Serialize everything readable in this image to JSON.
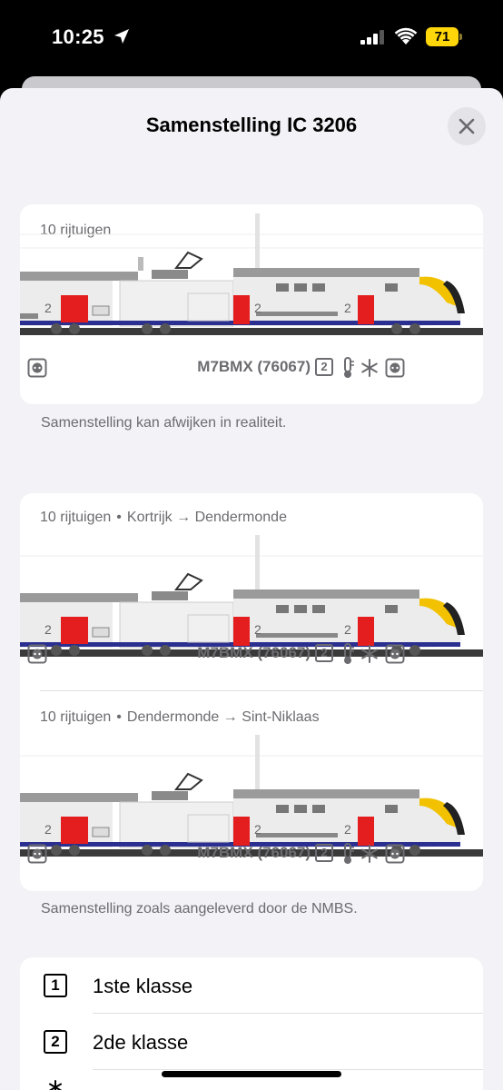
{
  "status_bar": {
    "time": "10:25",
    "battery": "71"
  },
  "sheet": {
    "title": "Samenstelling IC 3206"
  },
  "cards": [
    {
      "caption_count": "10 rijtuigen",
      "model": "M7BMX (76067)",
      "class_label": "2"
    },
    {
      "caption_count": "10 rijtuigen",
      "from": "Kortrijk",
      "to": "Dendermonde",
      "model": "M7BMX (76067)",
      "class_label": "2"
    },
    {
      "caption_count": "10 rijtuigen",
      "from": "Dendermonde",
      "to": "Sint-Niklaas",
      "model": "M7BMX (76067)",
      "class_label": "2"
    }
  ],
  "notes": {
    "first": "Samenstelling kan afwijken in realiteit.",
    "second": "Samenstelling zoals aangeleverd door de NMBS."
  },
  "separator": "•",
  "arrow": "→",
  "train_labels": {
    "class_number": "2"
  },
  "legend": [
    {
      "box": "1",
      "label": "1ste klasse"
    },
    {
      "box": "2",
      "label": "2de klasse"
    }
  ],
  "colors": {
    "accent_yellow": "#ffd60a",
    "door_red": "#e41e1e",
    "stripe_blue": "#2b2f8f",
    "nose_yellow": "#f2c200"
  }
}
